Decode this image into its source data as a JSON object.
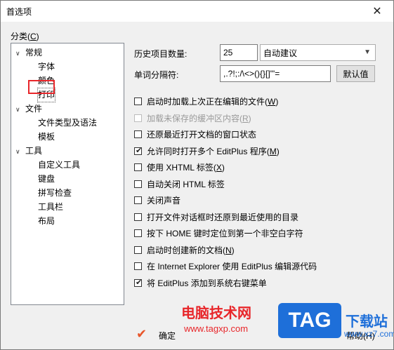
{
  "window": {
    "title": "首选项",
    "close_glyph": "✕"
  },
  "category": {
    "label": "分类(",
    "hotkey": "C",
    "suffix": ")"
  },
  "tree": {
    "nodes": [
      {
        "label": "常规",
        "expandable": true,
        "expanded": true
      },
      {
        "label": "字体"
      },
      {
        "label": "颜色"
      },
      {
        "label": "打印",
        "selected": true
      },
      {
        "label": "文件",
        "expandable": true,
        "expanded": true
      },
      {
        "label": "文件类型及语法"
      },
      {
        "label": "模板"
      },
      {
        "label": "工具",
        "expandable": true,
        "expanded": true
      },
      {
        "label": "自定义工具"
      },
      {
        "label": "键盘"
      },
      {
        "label": "拼写检查"
      },
      {
        "label": "工具栏"
      },
      {
        "label": "布局"
      }
    ]
  },
  "history": {
    "label": "历史项目数量:",
    "value": "25",
    "select_value": "自动建议"
  },
  "separator": {
    "label": "单词分隔符:",
    "value": ",.?!;:/\\<>(){}[]\"'=",
    "default_button": "默认值"
  },
  "options": [
    {
      "pre": "启动时加载上次正在编辑的文件(",
      "key": "W",
      "post": ")",
      "checked": false,
      "disabled": false
    },
    {
      "pre": "加载未保存的缓冲区内容(",
      "key": "R",
      "post": ")",
      "checked": false,
      "disabled": true
    },
    {
      "pre": "还原最近打开文档的窗口状态",
      "key": "",
      "post": "",
      "checked": false,
      "disabled": false
    },
    {
      "pre": "允许同时打开多个 EditPlus 程序(",
      "key": "M",
      "post": ")",
      "checked": true,
      "disabled": false
    },
    {
      "pre": "使用 XHTML 标签(",
      "key": "X",
      "post": ")",
      "checked": false,
      "disabled": false
    },
    {
      "pre": "自动关闭 HTML 标签",
      "key": "",
      "post": "",
      "checked": false,
      "disabled": false
    },
    {
      "pre": "关闭声音",
      "key": "",
      "post": "",
      "checked": false,
      "disabled": false
    },
    {
      "pre": "打开文件对话框时还原到最近使用的目录",
      "key": "",
      "post": "",
      "checked": false,
      "disabled": false
    },
    {
      "pre": "按下 HOME 键时定位到第一个非空白字符",
      "key": "",
      "post": "",
      "checked": false,
      "disabled": false
    },
    {
      "pre": "启动时创建新的文档(",
      "key": "N",
      "post": ")",
      "checked": false,
      "disabled": false
    },
    {
      "pre": "在 Internet Explorer 使用 EditPlus 编辑源代码",
      "key": "",
      "post": "",
      "checked": false,
      "disabled": false
    },
    {
      "pre": "将 EditPlus 添加到系统右键菜单",
      "key": "",
      "post": "",
      "checked": true,
      "disabled": false
    }
  ],
  "footer": {
    "ok_label": "确定",
    "help_label": "帮助(H)"
  },
  "watermark": {
    "cn": "电脑技术网",
    "url": "www.tagxp.com",
    "tag": "TAG",
    "download": "下载站",
    "url2": "www.xz7.com"
  },
  "colors": {
    "annotation": "#e8262a",
    "watermark_blue": "#1e6fd9"
  }
}
